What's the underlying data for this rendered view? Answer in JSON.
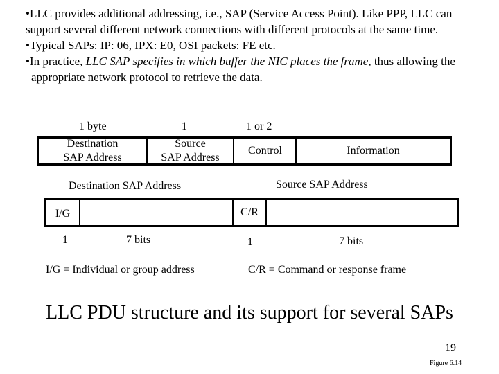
{
  "bullets": [
    {
      "text": "•LLC provides additional addressing, i.e., SAP (Service Access Point).  Like PPP, LLC can support several different network connections with different protocols at the same time."
    },
    {
      "text": "•Typical SAPs: IP: 06, IPX: E0, OSI packets: FE  etc."
    },
    {
      "prefix": "•In practice, ",
      "italic": "LLC SAP specifies in which buffer the NIC places the frame",
      "suffix": ", thus allowing the",
      "cont": "appropriate network protocol to retrieve the data."
    }
  ],
  "pdu": {
    "sizes": [
      "1 byte",
      "1",
      "1 or 2"
    ],
    "fields": [
      {
        "line1": "Destination",
        "line2": "SAP Address"
      },
      {
        "line1": "Source",
        "line2": "SAP Address"
      },
      {
        "line1": "Control",
        "line2": ""
      },
      {
        "line1": "Information",
        "line2": ""
      }
    ]
  },
  "addr": {
    "dest_label": "Destination SAP Address",
    "src_label": "Source SAP Address",
    "ig": "I/G",
    "cr": "C/R",
    "ig_bits": "1",
    "dest_bits": "7 bits",
    "cr_bits": "1",
    "src_bits": "7 bits",
    "ig_def": "I/G = Individual or group address",
    "cr_def": "C/R = Command or response frame"
  },
  "caption": "LLC PDU structure and its support for several SAPs",
  "page_number": "19",
  "figure_label": "Figure 6.14"
}
